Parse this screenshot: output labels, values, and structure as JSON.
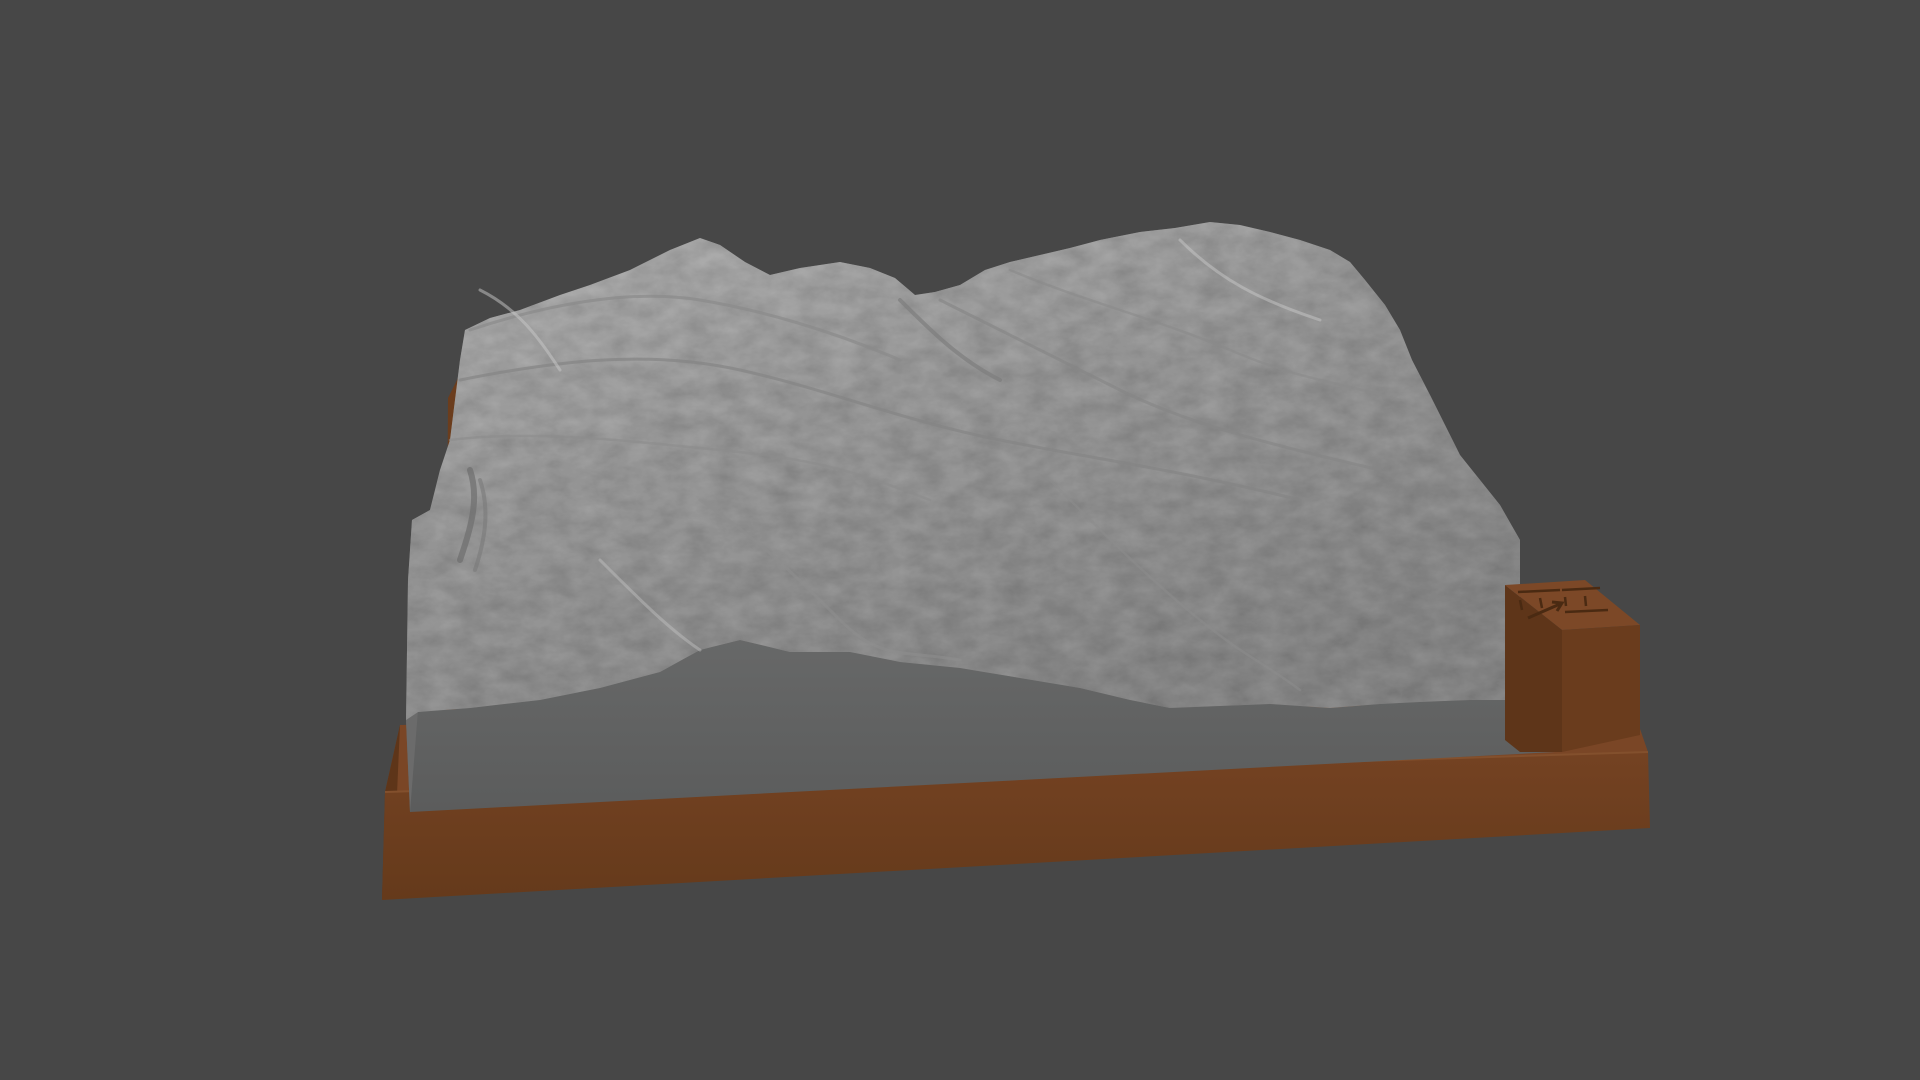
{
  "viewport": {
    "background": "#474747"
  },
  "model": {
    "terrain_top_color": "#a3a3a3",
    "terrain_face_color": "#5f6060",
    "base_color": "#6e3f1f",
    "base_front_color": "#673a1c",
    "base_top_color": "#7a4626",
    "marker_block": {
      "color": "#6a3c1d",
      "icons": [
        "grid-lines-icon",
        "north-arrow-icon"
      ]
    }
  }
}
